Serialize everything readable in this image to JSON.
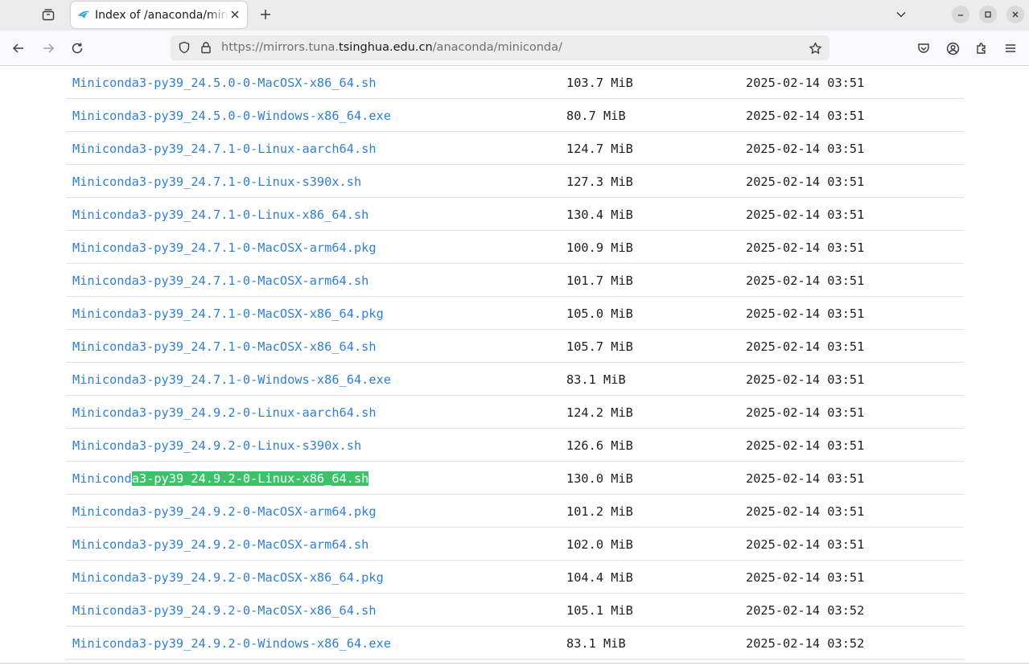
{
  "browser": {
    "tab": {
      "title": "Index of /anaconda/miniconda/"
    },
    "url": {
      "scheme": "https://",
      "subdomain": "mirrors.tuna.",
      "domain": "tsinghua.edu.cn",
      "path": "/anaconda/miniconda/"
    },
    "icons": {
      "tab_list": "tab-list-icon",
      "new_tab": "plus-icon",
      "all_tabs": "chevron-down-icon",
      "back": "arrow-left-icon",
      "forward": "arrow-right-icon",
      "reload": "reload-icon",
      "shield": "shield-icon",
      "lock": "lock-icon",
      "bookmark": "star-icon",
      "pocket": "pocket-icon",
      "account": "account-icon",
      "extensions": "puzzle-icon",
      "menu": "hamburger-menu-icon"
    }
  },
  "listing": {
    "highlight_color": "#3cc36a",
    "link_color": "#2f7fd6",
    "rows": [
      {
        "name": "Miniconda3-py39_24.5.0-0-MacOSX-x86_64.sh",
        "size": "103.7 MiB",
        "date": "2025-02-14 03:51"
      },
      {
        "name": "Miniconda3-py39_24.5.0-0-Windows-x86_64.exe",
        "size": "80.7 MiB",
        "date": "2025-02-14 03:51"
      },
      {
        "name": "Miniconda3-py39_24.7.1-0-Linux-aarch64.sh",
        "size": "124.7 MiB",
        "date": "2025-02-14 03:51"
      },
      {
        "name": "Miniconda3-py39_24.7.1-0-Linux-s390x.sh",
        "size": "127.3 MiB",
        "date": "2025-02-14 03:51"
      },
      {
        "name": "Miniconda3-py39_24.7.1-0-Linux-x86_64.sh",
        "size": "130.4 MiB",
        "date": "2025-02-14 03:51"
      },
      {
        "name": "Miniconda3-py39_24.7.1-0-MacOSX-arm64.pkg",
        "size": "100.9 MiB",
        "date": "2025-02-14 03:51"
      },
      {
        "name": "Miniconda3-py39_24.7.1-0-MacOSX-arm64.sh",
        "size": "101.7 MiB",
        "date": "2025-02-14 03:51"
      },
      {
        "name": "Miniconda3-py39_24.7.1-0-MacOSX-x86_64.pkg",
        "size": "105.0 MiB",
        "date": "2025-02-14 03:51"
      },
      {
        "name": "Miniconda3-py39_24.7.1-0-MacOSX-x86_64.sh",
        "size": "105.7 MiB",
        "date": "2025-02-14 03:51"
      },
      {
        "name": "Miniconda3-py39_24.7.1-0-Windows-x86_64.exe",
        "size": "83.1 MiB",
        "date": "2025-02-14 03:51"
      },
      {
        "name": "Miniconda3-py39_24.9.2-0-Linux-aarch64.sh",
        "size": "124.2 MiB",
        "date": "2025-02-14 03:51"
      },
      {
        "name": "Miniconda3-py39_24.9.2-0-Linux-s390x.sh",
        "size": "126.6 MiB",
        "date": "2025-02-14 03:51"
      },
      {
        "name_pre": "Minicond",
        "name_sel": "a3-py39_24.9.2-0-Linux-x86_64.sh",
        "size": "130.0 MiB",
        "date": "2025-02-14 03:51",
        "selected": true
      },
      {
        "name": "Miniconda3-py39_24.9.2-0-MacOSX-arm64.pkg",
        "size": "101.2 MiB",
        "date": "2025-02-14 03:51"
      },
      {
        "name": "Miniconda3-py39_24.9.2-0-MacOSX-arm64.sh",
        "size": "102.0 MiB",
        "date": "2025-02-14 03:51"
      },
      {
        "name": "Miniconda3-py39_24.9.2-0-MacOSX-x86_64.pkg",
        "size": "104.4 MiB",
        "date": "2025-02-14 03:51"
      },
      {
        "name": "Miniconda3-py39_24.9.2-0-MacOSX-x86_64.sh",
        "size": "105.1 MiB",
        "date": "2025-02-14 03:52"
      },
      {
        "name": "Miniconda3-py39_24.9.2-0-Windows-x86_64.exe",
        "size": "83.1 MiB",
        "date": "2025-02-14 03:52"
      }
    ]
  }
}
